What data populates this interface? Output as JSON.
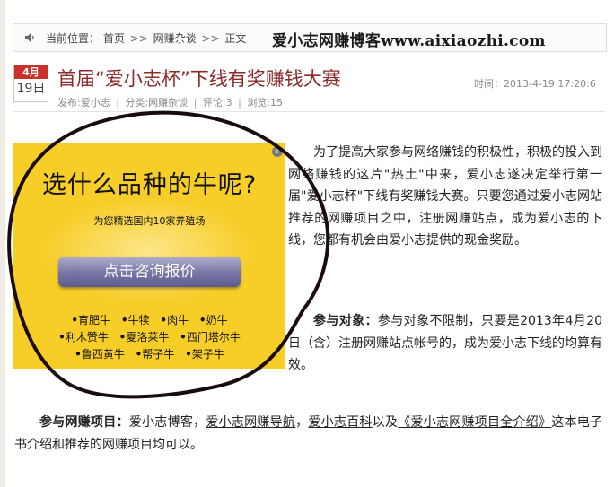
{
  "breadcrumb": {
    "prefix": "当前位置：",
    "items": [
      "首页",
      "网赚杂谈",
      "正文"
    ],
    "separator": ">>"
  },
  "site_watermark": "爱小志网赚博客www.aixiaozhi.com",
  "post": {
    "date_month": "4月",
    "date_day": "19日",
    "title": "首届“爱小志杯”下线有奖赚钱大赛",
    "time": "时间：2013-4-19 17:20:6",
    "meta": {
      "author": "发布:爱小志",
      "category": "分类:网赚杂谈",
      "comments": "评论:3",
      "views": "浏览:15",
      "separator": "|"
    }
  },
  "ad": {
    "headline": "选什么品种的牛呢?",
    "subline": "为您精选国内10家养殖场",
    "cta_label": "点击咨询报价",
    "info_glyph": "i",
    "tag_rows": [
      [
        "育肥牛",
        "牛犊",
        "肉牛",
        "奶牛"
      ],
      [
        "利木赞牛",
        "夏洛莱牛",
        "西门塔尔牛"
      ],
      [
        "鲁西黄牛",
        "帮子牛",
        "架子牛"
      ]
    ]
  },
  "article": {
    "p1": "为了提高大家参与网络赚钱的积极性，积极的投入到网络赚钱的这片\"热土\"中来，爱小志遂决定举行第一届\"爱小志杯\"下线有奖赚钱大赛。只要您通过爱小志网站推荐的网赚项目之中，注册网赚站点，成为爱小志的下线，您都有机会由爱小志提供的现金奖励。",
    "p2_label": "参与对象：",
    "p2_text": "参与对象不限制，只要是2013年4月20日（含）注册网赚站点帐号的，成为爱小志下线的均算有效。",
    "p3_label": "参与网赚项目：",
    "p3_pre": "爱小志博客，",
    "p3_link1": "爱小志网赚导航",
    "p3_mid1": "，",
    "p3_link2": "爱小志百科",
    "p3_mid2": "以及",
    "p3_link3": "《爱小志网赚项目全介绍》",
    "p3_post": "这本电子书介绍和推荐的网赚项目均可以。"
  },
  "colors": {
    "title": "#8c2a2a",
    "ad_background": "#f7cd28",
    "date_badge": "#c8322b",
    "annotation_stroke": "#1a0c0c"
  },
  "icons": {
    "speaker": "speaker-icon",
    "ad_info": "info-icon"
  }
}
